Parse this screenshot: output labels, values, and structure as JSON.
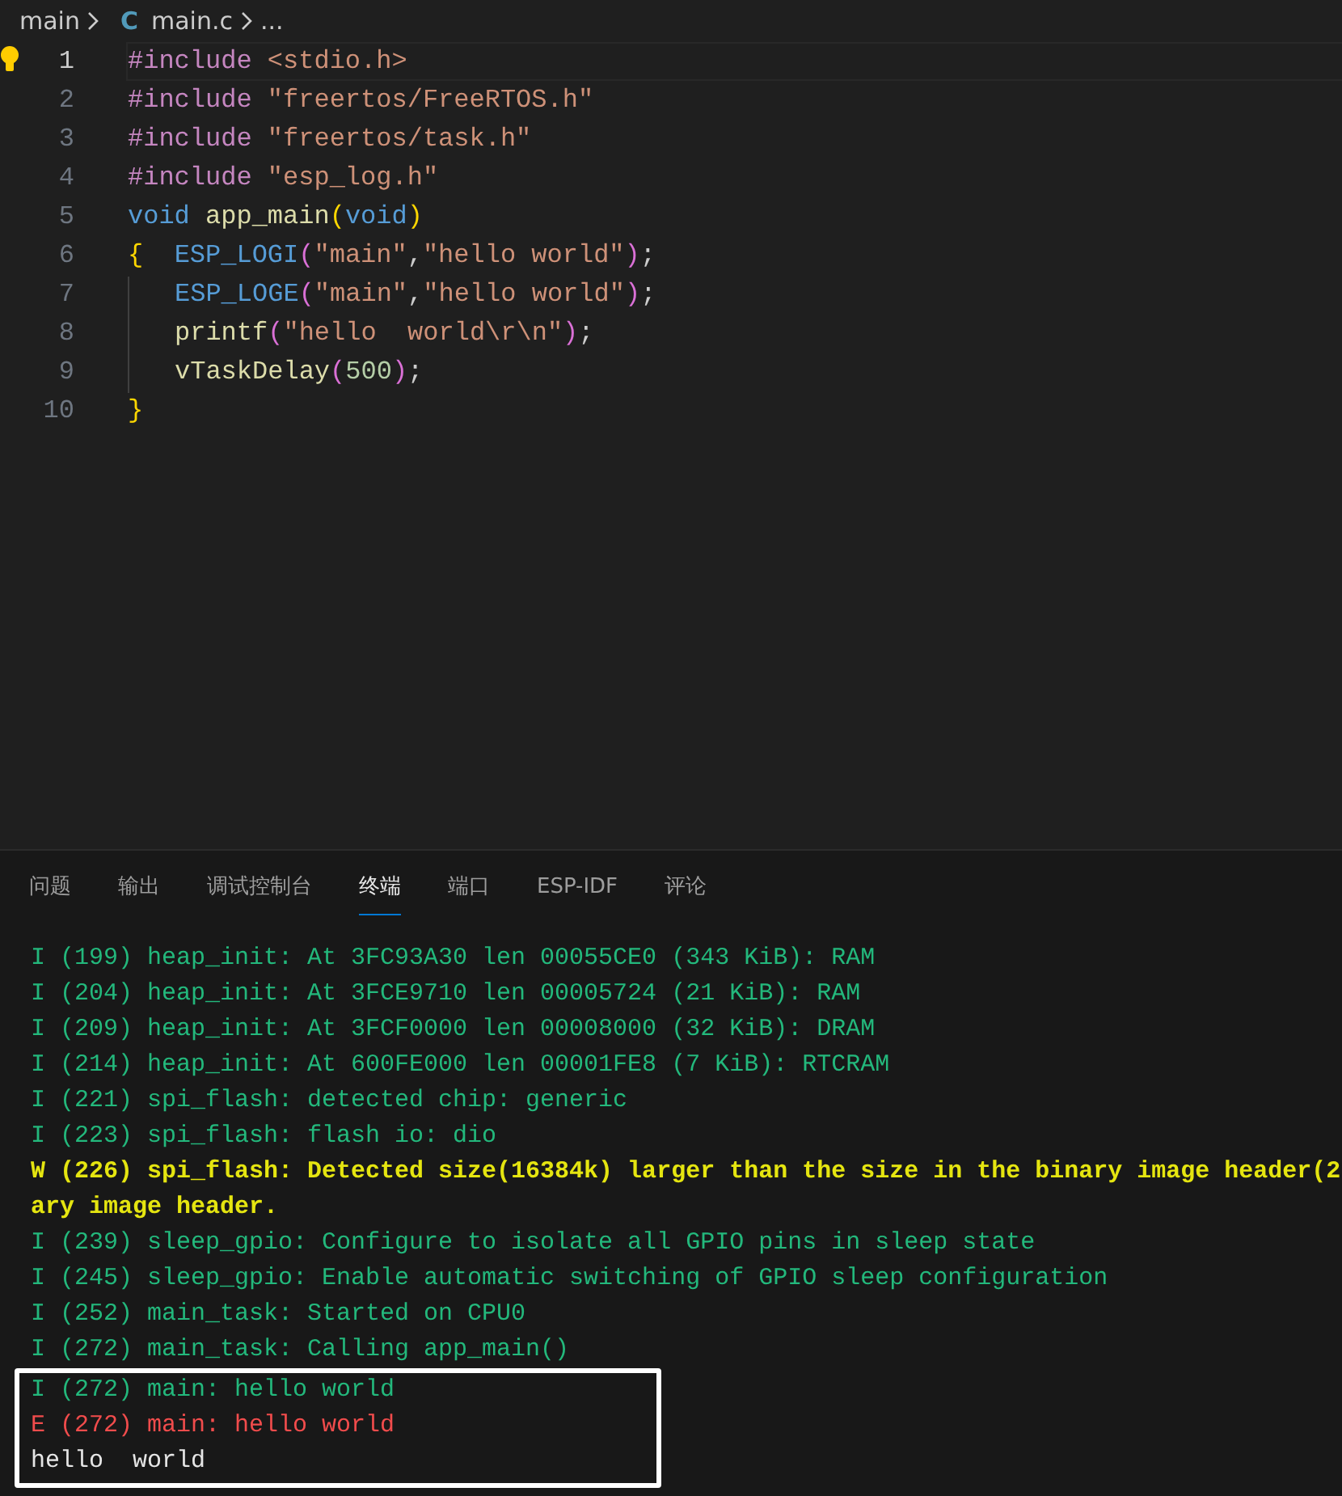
{
  "breadcrumb": {
    "folder": "main",
    "file_icon": "C",
    "file": "main.c",
    "more": "..."
  },
  "editor": {
    "lines": [
      {
        "number": "1",
        "current": true,
        "hint": true,
        "indent": false,
        "tokens": [
          {
            "kind": "preproc",
            "text": "#include "
          },
          {
            "kind": "string",
            "text": "<stdio.h>"
          }
        ]
      },
      {
        "number": "2",
        "current": false,
        "hint": false,
        "indent": false,
        "tokens": [
          {
            "kind": "preproc",
            "text": "#include "
          },
          {
            "kind": "string",
            "text": "\"freertos/FreeRTOS.h\""
          }
        ]
      },
      {
        "number": "3",
        "current": false,
        "hint": false,
        "indent": false,
        "tokens": [
          {
            "kind": "preproc",
            "text": "#include "
          },
          {
            "kind": "string",
            "text": "\"freertos/task.h\""
          }
        ]
      },
      {
        "number": "4",
        "current": false,
        "hint": false,
        "indent": false,
        "tokens": [
          {
            "kind": "preproc",
            "text": "#include "
          },
          {
            "kind": "string",
            "text": "\"esp_log.h\""
          }
        ]
      },
      {
        "number": "5",
        "current": false,
        "hint": false,
        "indent": false,
        "tokens": [
          {
            "kind": "keyword",
            "text": "void "
          },
          {
            "kind": "function",
            "text": "app_main"
          },
          {
            "kind": "bracket1",
            "text": "("
          },
          {
            "kind": "keyword",
            "text": "void"
          },
          {
            "kind": "bracket1",
            "text": ")"
          }
        ]
      },
      {
        "number": "6",
        "current": false,
        "hint": false,
        "indent": false,
        "tokens": [
          {
            "kind": "bracket1",
            "text": "{  "
          },
          {
            "kind": "keyword",
            "text": "ESP_LOGI"
          },
          {
            "kind": "bracket2",
            "text": "("
          },
          {
            "kind": "string",
            "text": "\"main\""
          },
          {
            "kind": "plain",
            "text": ","
          },
          {
            "kind": "string",
            "text": "\"hello world\""
          },
          {
            "kind": "bracket2",
            "text": ")"
          },
          {
            "kind": "plain",
            "text": ";"
          }
        ]
      },
      {
        "number": "7",
        "current": false,
        "hint": false,
        "indent": true,
        "tokens": [
          {
            "kind": "keyword",
            "text": "ESP_LOGE"
          },
          {
            "kind": "bracket2",
            "text": "("
          },
          {
            "kind": "string",
            "text": "\"main\""
          },
          {
            "kind": "plain",
            "text": ","
          },
          {
            "kind": "string",
            "text": "\"hello world\""
          },
          {
            "kind": "bracket2",
            "text": ")"
          },
          {
            "kind": "plain",
            "text": ";"
          }
        ]
      },
      {
        "number": "8",
        "current": false,
        "hint": false,
        "indent": true,
        "tokens": [
          {
            "kind": "function",
            "text": "printf"
          },
          {
            "kind": "bracket2",
            "text": "("
          },
          {
            "kind": "string",
            "text": "\"hello  world\\r\\n\""
          },
          {
            "kind": "bracket2",
            "text": ")"
          },
          {
            "kind": "plain",
            "text": ";"
          }
        ]
      },
      {
        "number": "9",
        "current": false,
        "hint": false,
        "indent": true,
        "tokens": [
          {
            "kind": "function",
            "text": "vTaskDelay"
          },
          {
            "kind": "bracket2",
            "text": "("
          },
          {
            "kind": "number",
            "text": "500"
          },
          {
            "kind": "bracket2",
            "text": ")"
          },
          {
            "kind": "plain",
            "text": ";"
          }
        ]
      },
      {
        "number": "10",
        "current": false,
        "hint": false,
        "indent": false,
        "tokens": [
          {
            "kind": "bracket1",
            "text": "}"
          }
        ]
      }
    ]
  },
  "panel": {
    "tabs": [
      {
        "label": "问题",
        "selected": false
      },
      {
        "label": "输出",
        "selected": false
      },
      {
        "label": "调试控制台",
        "selected": false
      },
      {
        "label": "终端",
        "selected": true
      },
      {
        "label": "端口",
        "selected": false
      },
      {
        "label": "ESP-IDF",
        "selected": false
      },
      {
        "label": "评论",
        "selected": false
      }
    ],
    "terminal": [
      {
        "kind": "info",
        "text": "I (199) heap_init: At 3FC93A30 len 00055CE0 (343 KiB): RAM"
      },
      {
        "kind": "info",
        "text": "I (204) heap_init: At 3FCE9710 len 00005724 (21 KiB): RAM"
      },
      {
        "kind": "info",
        "text": "I (209) heap_init: At 3FCF0000 len 00008000 (32 KiB): DRAM"
      },
      {
        "kind": "info",
        "text": "I (214) heap_init: At 600FE000 len 00001FE8 (7 KiB): RTCRAM"
      },
      {
        "kind": "info",
        "text": "I (221) spi_flash: detected chip: generic"
      },
      {
        "kind": "info",
        "text": "I (223) spi_flash: flash io: dio"
      },
      {
        "kind": "warn",
        "text": "W (226) spi_flash: Detected size(16384k) larger than the size in the binary image header(2"
      },
      {
        "kind": "warn",
        "text": "ary image header."
      },
      {
        "kind": "info",
        "text": "I (239) sleep_gpio: Configure to isolate all GPIO pins in sleep state"
      },
      {
        "kind": "info",
        "text": "I (245) sleep_gpio: Enable automatic switching of GPIO sleep configuration"
      },
      {
        "kind": "info",
        "text": "I (252) main_task: Started on CPU0"
      },
      {
        "kind": "info",
        "text": "I (272) main_task: Calling app_main()"
      },
      {
        "kind": "info",
        "text": "I (272) main: hello world",
        "boxed": true
      },
      {
        "kind": "error",
        "text": "E (272) main: hello world",
        "boxed": true
      },
      {
        "kind": "plain",
        "text": "hello  world",
        "boxed": true
      }
    ]
  }
}
